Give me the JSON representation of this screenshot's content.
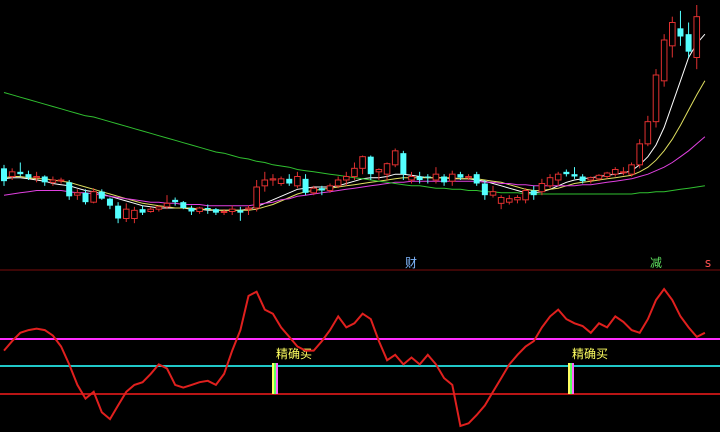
{
  "colors": {
    "background": "#000000",
    "candle_up": "#e03030",
    "candle_down": "#54ffff",
    "ma_fast": "#ffffff",
    "ma_mid": "#e0e060",
    "ma_slow": "#e040e0",
    "ma_long": "#30c030",
    "separator": "#7a0d0d",
    "oscillator": "#e0201e",
    "level_high": "#ff30ff",
    "level_mid": "#20c8c8",
    "level_low": "#b81515",
    "signal_text": "#ffff60",
    "marker_cai": "#80b8ff",
    "marker_jian": "#60e060",
    "marker_s": "#ff5050"
  },
  "markers": [
    {
      "label": "财",
      "role": "marker_cai"
    },
    {
      "label": "减",
      "role": "marker_jian"
    },
    {
      "label": "s",
      "role": "marker_s"
    }
  ],
  "signals": [
    {
      "label": "精确买",
      "index": 11
    },
    {
      "label": "精确买",
      "index": 40
    }
  ],
  "chart_data": [
    {
      "type": "candlestick",
      "title": "",
      "grid": false,
      "ylim": [
        0,
        100
      ],
      "candles": [
        {
          "o": 65,
          "h": 68,
          "l": 50,
          "c": 54
        },
        {
          "o": 58,
          "h": 65,
          "l": 55,
          "c": 62
        },
        {
          "o": 62,
          "h": 70,
          "l": 58,
          "c": 60
        },
        {
          "o": 60,
          "h": 63,
          "l": 55,
          "c": 57
        },
        {
          "o": 57,
          "h": 62,
          "l": 53,
          "c": 58
        },
        {
          "o": 58,
          "h": 59,
          "l": 50,
          "c": 53
        },
        {
          "o": 53,
          "h": 58,
          "l": 50,
          "c": 55
        },
        {
          "o": 55,
          "h": 57,
          "l": 52,
          "c": 55
        },
        {
          "o": 53,
          "h": 55,
          "l": 38,
          "c": 41
        },
        {
          "o": 42,
          "h": 47,
          "l": 38,
          "c": 44
        },
        {
          "o": 44,
          "h": 47,
          "l": 34,
          "c": 36
        },
        {
          "o": 36,
          "h": 48,
          "l": 35,
          "c": 45
        },
        {
          "o": 45,
          "h": 47,
          "l": 38,
          "c": 39
        },
        {
          "o": 39,
          "h": 40,
          "l": 30,
          "c": 33
        },
        {
          "o": 33,
          "h": 36,
          "l": 18,
          "c": 22
        },
        {
          "o": 22,
          "h": 35,
          "l": 19,
          "c": 30
        },
        {
          "o": 22,
          "h": 32,
          "l": 18,
          "c": 29
        },
        {
          "o": 30,
          "h": 33,
          "l": 25,
          "c": 27
        },
        {
          "o": 28,
          "h": 32,
          "l": 27,
          "c": 30
        },
        {
          "o": 30,
          "h": 33,
          "l": 28,
          "c": 32
        },
        {
          "o": 32,
          "h": 42,
          "l": 30,
          "c": 35
        },
        {
          "o": 38,
          "h": 40,
          "l": 33,
          "c": 36
        },
        {
          "o": 36,
          "h": 37,
          "l": 30,
          "c": 31
        },
        {
          "o": 31,
          "h": 33,
          "l": 25,
          "c": 28
        },
        {
          "o": 28,
          "h": 32,
          "l": 26,
          "c": 31
        },
        {
          "o": 31,
          "h": 34,
          "l": 26,
          "c": 30
        },
        {
          "o": 30,
          "h": 31,
          "l": 25,
          "c": 27
        },
        {
          "o": 28,
          "h": 30,
          "l": 25,
          "c": 28
        },
        {
          "o": 28,
          "h": 33,
          "l": 25,
          "c": 30
        },
        {
          "o": 29,
          "h": 32,
          "l": 20,
          "c": 27
        },
        {
          "o": 30,
          "h": 33,
          "l": 25,
          "c": 31
        },
        {
          "o": 31,
          "h": 55,
          "l": 28,
          "c": 49
        },
        {
          "o": 50,
          "h": 62,
          "l": 45,
          "c": 55
        },
        {
          "o": 55,
          "h": 60,
          "l": 50,
          "c": 56
        },
        {
          "o": 52,
          "h": 58,
          "l": 50,
          "c": 56
        },
        {
          "o": 56,
          "h": 60,
          "l": 50,
          "c": 52
        },
        {
          "o": 50,
          "h": 62,
          "l": 48,
          "c": 58
        },
        {
          "o": 56,
          "h": 60,
          "l": 42,
          "c": 44
        },
        {
          "o": 44,
          "h": 50,
          "l": 42,
          "c": 48
        },
        {
          "o": 48,
          "h": 50,
          "l": 42,
          "c": 46
        },
        {
          "o": 46,
          "h": 52,
          "l": 44,
          "c": 50
        },
        {
          "o": 50,
          "h": 58,
          "l": 48,
          "c": 55
        },
        {
          "o": 55,
          "h": 62,
          "l": 50,
          "c": 58
        },
        {
          "o": 58,
          "h": 70,
          "l": 55,
          "c": 65
        },
        {
          "o": 65,
          "h": 76,
          "l": 60,
          "c": 75
        },
        {
          "o": 75,
          "h": 76,
          "l": 55,
          "c": 60
        },
        {
          "o": 62,
          "h": 65,
          "l": 55,
          "c": 64
        },
        {
          "o": 60,
          "h": 70,
          "l": 55,
          "c": 69
        },
        {
          "o": 68,
          "h": 82,
          "l": 66,
          "c": 80
        },
        {
          "o": 78,
          "h": 80,
          "l": 55,
          "c": 60
        },
        {
          "o": 55,
          "h": 62,
          "l": 52,
          "c": 58
        },
        {
          "o": 58,
          "h": 62,
          "l": 52,
          "c": 55
        },
        {
          "o": 58,
          "h": 60,
          "l": 52,
          "c": 57
        },
        {
          "o": 55,
          "h": 66,
          "l": 52,
          "c": 60
        },
        {
          "o": 58,
          "h": 60,
          "l": 50,
          "c": 53
        },
        {
          "o": 54,
          "h": 63,
          "l": 50,
          "c": 60
        },
        {
          "o": 60,
          "h": 62,
          "l": 55,
          "c": 57
        },
        {
          "o": 57,
          "h": 60,
          "l": 55,
          "c": 58
        },
        {
          "o": 60,
          "h": 62,
          "l": 50,
          "c": 52
        },
        {
          "o": 52,
          "h": 55,
          "l": 38,
          "c": 42
        },
        {
          "o": 42,
          "h": 50,
          "l": 40,
          "c": 45
        },
        {
          "o": 35,
          "h": 42,
          "l": 30,
          "c": 40
        },
        {
          "o": 36,
          "h": 42,
          "l": 34,
          "c": 39
        },
        {
          "o": 38,
          "h": 42,
          "l": 35,
          "c": 40
        },
        {
          "o": 38,
          "h": 48,
          "l": 35,
          "c": 46
        },
        {
          "o": 46,
          "h": 50,
          "l": 38,
          "c": 42
        },
        {
          "o": 45,
          "h": 56,
          "l": 42,
          "c": 52
        },
        {
          "o": 50,
          "h": 60,
          "l": 48,
          "c": 57
        },
        {
          "o": 55,
          "h": 62,
          "l": 50,
          "c": 60
        },
        {
          "o": 62,
          "h": 64,
          "l": 58,
          "c": 60
        },
        {
          "o": 60,
          "h": 66,
          "l": 56,
          "c": 58
        },
        {
          "o": 58,
          "h": 60,
          "l": 52,
          "c": 54
        },
        {
          "o": 55,
          "h": 58,
          "l": 52,
          "c": 57
        },
        {
          "o": 56,
          "h": 60,
          "l": 54,
          "c": 59
        },
        {
          "o": 58,
          "h": 62,
          "l": 56,
          "c": 61
        },
        {
          "o": 60,
          "h": 66,
          "l": 58,
          "c": 64
        },
        {
          "o": 62,
          "h": 66,
          "l": 59,
          "c": 62
        },
        {
          "o": 60,
          "h": 70,
          "l": 58,
          "c": 68
        },
        {
          "o": 68,
          "h": 90,
          "l": 65,
          "c": 86
        },
        {
          "o": 86,
          "h": 110,
          "l": 84,
          "c": 105
        },
        {
          "o": 105,
          "h": 150,
          "l": 100,
          "c": 145
        },
        {
          "o": 140,
          "h": 180,
          "l": 135,
          "c": 175
        },
        {
          "o": 170,
          "h": 195,
          "l": 160,
          "c": 190
        },
        {
          "o": 185,
          "h": 200,
          "l": 170,
          "c": 178
        },
        {
          "o": 180,
          "h": 190,
          "l": 160,
          "c": 165
        },
        {
          "o": 160,
          "h": 205,
          "l": 150,
          "c": 195
        }
      ],
      "series": [
        {
          "values": [
            56,
            57,
            57,
            56,
            55,
            54,
            52,
            51,
            50,
            48,
            46,
            45,
            43,
            41,
            39,
            37,
            35,
            33,
            32,
            31,
            31,
            31,
            31,
            30,
            30,
            29,
            29,
            29,
            29,
            29,
            30,
            32,
            35,
            38,
            41,
            44,
            47,
            48,
            49,
            49,
            49,
            50,
            52,
            54,
            56,
            57,
            57,
            58,
            60,
            60,
            59,
            58,
            57,
            57,
            57,
            56,
            56,
            56,
            55,
            54,
            52,
            50,
            48,
            46,
            44,
            44,
            45,
            47,
            50,
            53,
            55,
            56,
            57,
            58,
            59,
            60,
            61,
            63,
            68,
            75,
            85,
            100,
            120,
            140,
            160,
            172,
            180
          ]
        },
        {
          "values": [
            57,
            58,
            58,
            57,
            56,
            56,
            55,
            54,
            53,
            51,
            49,
            47,
            45,
            43,
            41,
            39,
            37,
            35,
            34,
            33,
            32,
            31,
            31,
            31,
            30,
            30,
            29,
            29,
            29,
            29,
            29,
            30,
            32,
            34,
            37,
            40,
            43,
            45,
            46,
            47,
            48,
            49,
            50,
            51,
            52,
            53,
            54,
            55,
            56,
            57,
            57,
            57,
            57,
            57,
            57,
            57,
            56,
            56,
            56,
            55,
            54,
            53,
            51,
            49,
            47,
            46,
            46,
            47,
            48,
            50,
            52,
            53,
            54,
            55,
            56,
            57,
            58,
            59,
            62,
            66,
            72,
            80,
            90,
            102,
            115,
            128,
            140
          ]
        },
        {
          "values": [
            42,
            43,
            44,
            45,
            46,
            46,
            46,
            46,
            45,
            44,
            44,
            43,
            42,
            41,
            40,
            39,
            38,
            37,
            36,
            36,
            35,
            35,
            34,
            34,
            34,
            33,
            33,
            33,
            33,
            33,
            33,
            34,
            35,
            36,
            38,
            39,
            41,
            42,
            43,
            44,
            45,
            46,
            47,
            48,
            49,
            50,
            51,
            52,
            53,
            53,
            54,
            54,
            54,
            54,
            54,
            54,
            54,
            54,
            54,
            53,
            53,
            52,
            52,
            51,
            51,
            50,
            50,
            50,
            50,
            50,
            50,
            51,
            51,
            52,
            53,
            54,
            55,
            56,
            58,
            60,
            63,
            66,
            70,
            75,
            80,
            86,
            92
          ]
        },
        {
          "values": [
            130,
            128,
            126,
            124,
            122,
            120,
            118,
            116,
            114,
            112,
            110,
            109,
            107,
            105,
            103,
            101,
            99,
            97,
            95,
            93,
            91,
            89,
            87,
            85,
            83,
            81,
            79,
            78,
            76,
            74,
            73,
            71,
            70,
            68,
            67,
            66,
            64,
            63,
            62,
            61,
            60,
            59,
            58,
            57,
            56,
            55,
            54,
            53,
            52,
            51,
            50,
            50,
            49,
            48,
            48,
            47,
            47,
            46,
            46,
            45,
            45,
            44,
            44,
            44,
            43,
            43,
            43,
            43,
            43,
            43,
            43,
            43,
            43,
            43,
            43,
            43,
            43,
            43,
            44,
            44,
            45,
            45,
            46,
            47,
            48,
            49,
            50
          ]
        }
      ]
    },
    {
      "type": "line",
      "title": "",
      "grid": false,
      "ylim": [
        0,
        100
      ],
      "levels": [
        80,
        50,
        20
      ],
      "series": [
        {
          "values": [
            55,
            62,
            68,
            70,
            71,
            70,
            66,
            58,
            45,
            30,
            20,
            25,
            10,
            5,
            15,
            25,
            30,
            32,
            38,
            45,
            42,
            30,
            28,
            30,
            32,
            33,
            30,
            38,
            55,
            70,
            95,
            98,
            85,
            82,
            72,
            65,
            58,
            55,
            55,
            62,
            70,
            80,
            72,
            75,
            82,
            78,
            62,
            48,
            52,
            45,
            50,
            45,
            52,
            45,
            35,
            30,
            0,
            2,
            8,
            15,
            25,
            35,
            45,
            52,
            58,
            62,
            72,
            80,
            85,
            78,
            75,
            73,
            68,
            75,
            72,
            80,
            76,
            70,
            68,
            78,
            92,
            100,
            92,
            80,
            72,
            65,
            68
          ]
        }
      ]
    }
  ]
}
